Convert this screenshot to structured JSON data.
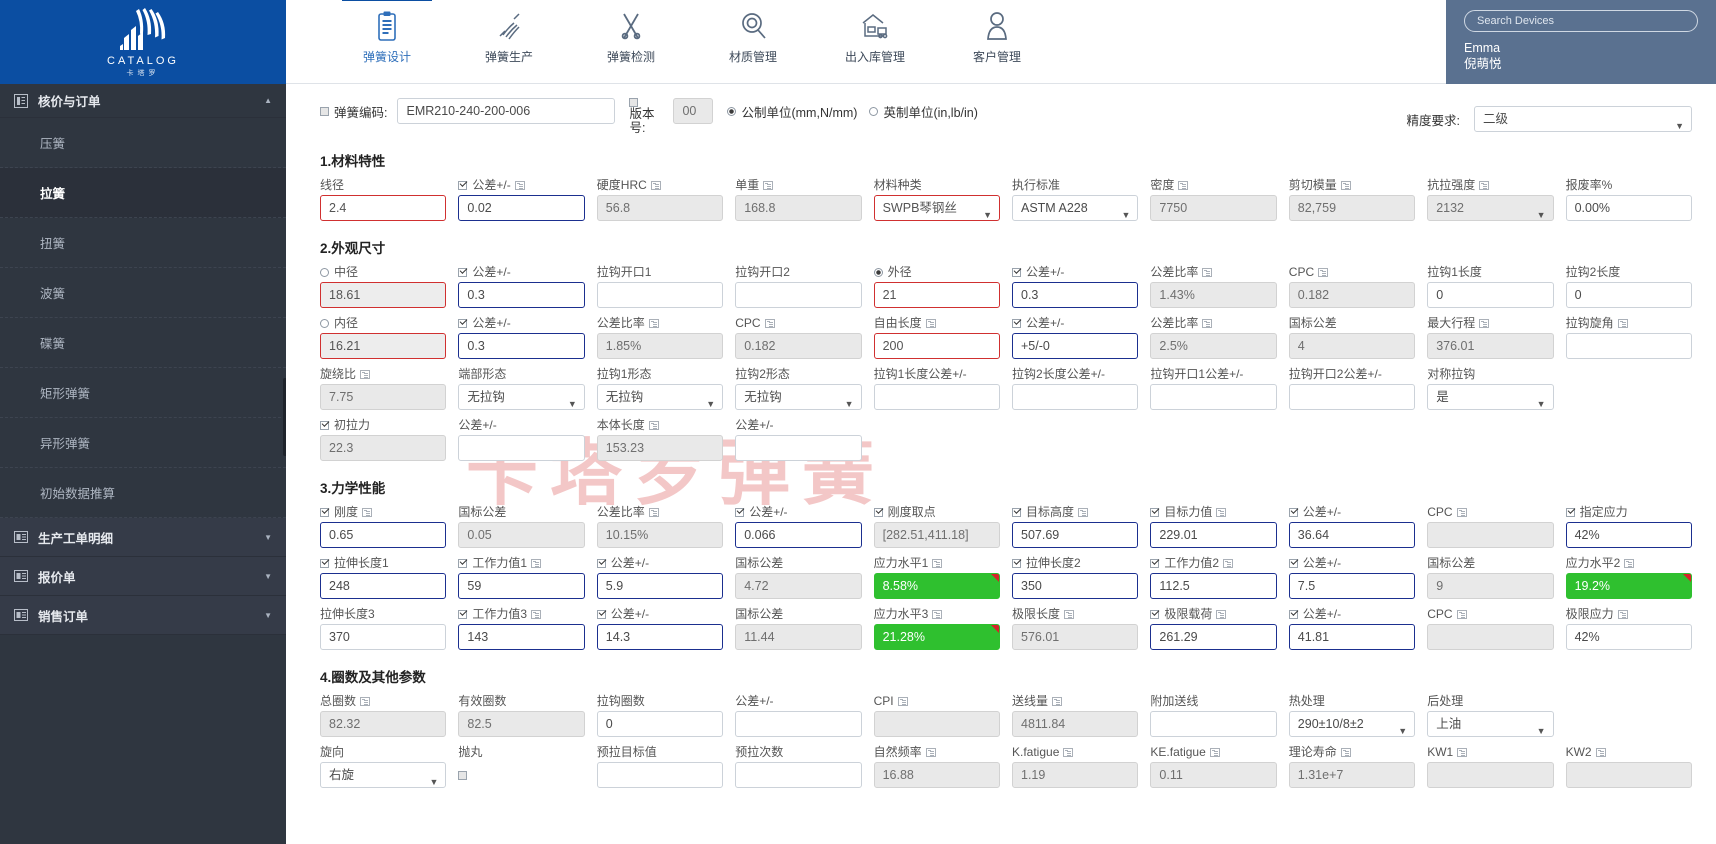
{
  "brand": {
    "name": "CATALOG",
    "sub": "卡塔罗"
  },
  "sidebar": {
    "group": {
      "label": "核价与订单",
      "icon": "list-icon"
    },
    "items": [
      {
        "label": "压簧"
      },
      {
        "label": "拉簧"
      },
      {
        "label": "扭簧"
      },
      {
        "label": "波簧"
      },
      {
        "label": "碟簧"
      },
      {
        "label": "矩形弹簧"
      },
      {
        "label": "异形弹簧"
      },
      {
        "label": "初始数据推算"
      }
    ],
    "groups2": [
      {
        "label": "生产工单明细"
      },
      {
        "label": "报价单"
      },
      {
        "label": "销售订单"
      }
    ]
  },
  "topnav": [
    {
      "label": "弹簧设计",
      "icon": "clipboard-icon",
      "active": true
    },
    {
      "label": "弹簧生产",
      "icon": "spring-icon",
      "active": false
    },
    {
      "label": "弹簧检测",
      "icon": "tools-icon",
      "active": false
    },
    {
      "label": "材质管理",
      "icon": "magnifier-coil-icon",
      "active": false
    },
    {
      "label": "出入库管理",
      "icon": "warehouse-truck-icon",
      "active": false
    },
    {
      "label": "客户管理",
      "icon": "user-icon",
      "active": false
    }
  ],
  "user": {
    "search_placeholder": "Search Devices",
    "name_en": "Emma",
    "name_cn": "倪萌悦"
  },
  "watermark": "卡塔罗弹簧",
  "header": {
    "code_label": "弹簧编码:",
    "code_value": "EMR210-240-200-006",
    "version_label": "版本号:",
    "version_value": "00",
    "unit_metric": "公制单位(mm,N/mm)",
    "unit_imperial": "英制单位(in,lb/in)",
    "precision_label": "精度要求:",
    "precision_value": "二级"
  },
  "sections": [
    {
      "title": "1.材料特性",
      "rows": [
        [
          {
            "label": "线径",
            "value": "2.4",
            "style": "redw",
            "check": "none"
          },
          {
            "label": "公差+/-",
            "value": "0.02",
            "style": "blue",
            "check": "on",
            "ico": true
          },
          {
            "label": "硬度HRC",
            "value": "56.8",
            "style": "gray",
            "check": "none",
            "ico": true
          },
          {
            "label": "单重",
            "value": "168.8",
            "style": "gray",
            "check": "none",
            "ico": true
          },
          {
            "label": "材料种类",
            "value": "SWPB琴钢丝",
            "style": "redw",
            "check": "none",
            "select": true
          },
          {
            "label": "执行标准",
            "value": "ASTM A228",
            "style": "plain",
            "check": "none",
            "select": true
          },
          {
            "label": "密度",
            "value": "7750",
            "style": "gray",
            "check": "none",
            "ico": true
          },
          {
            "label": "剪切模量",
            "value": "82,759",
            "style": "gray",
            "check": "none",
            "ico": true
          },
          {
            "label": "抗拉强度",
            "value": "2132",
            "style": "gray",
            "check": "none",
            "ico": true,
            "select": true
          },
          {
            "label": "报废率%",
            "value": "0.00%",
            "style": "plain",
            "check": "none"
          }
        ]
      ]
    },
    {
      "title": "2.外观尺寸",
      "rows": [
        [
          {
            "label": "中径",
            "value": "18.61",
            "style": "red",
            "check": "radio-off"
          },
          {
            "label": "公差+/-",
            "value": "0.3",
            "style": "blue",
            "check": "on"
          },
          {
            "label": "拉钩开口1",
            "value": "",
            "style": "plain",
            "check": "none"
          },
          {
            "label": "拉钩开口2",
            "value": "",
            "style": "plain",
            "check": "none"
          },
          {
            "label": "外径",
            "value": "21",
            "style": "redw",
            "check": "radio-on"
          },
          {
            "label": "公差+/-",
            "value": "0.3",
            "style": "blue",
            "check": "on"
          },
          {
            "label": "公差比率",
            "value": "1.43%",
            "style": "gray",
            "check": "none",
            "ico": true
          },
          {
            "label": "CPC",
            "value": "0.182",
            "style": "gray",
            "check": "none",
            "ico": true
          },
          {
            "label": "拉钩1长度",
            "value": "0",
            "style": "plain",
            "check": "none"
          },
          {
            "label": "拉钩2长度",
            "value": "0",
            "style": "plain",
            "check": "none"
          }
        ],
        [
          {
            "label": "内径",
            "value": "16.21",
            "style": "red",
            "check": "radio-off"
          },
          {
            "label": "公差+/-",
            "value": "0.3",
            "style": "blue",
            "check": "on"
          },
          {
            "label": "公差比率",
            "value": "1.85%",
            "style": "gray",
            "check": "none",
            "ico": true
          },
          {
            "label": "CPC",
            "value": "0.182",
            "style": "gray",
            "check": "none",
            "ico": true
          },
          {
            "label": "自由长度",
            "value": "200",
            "style": "redw",
            "check": "none",
            "ico": true
          },
          {
            "label": "公差+/-",
            "value": "+5/-0",
            "style": "blue",
            "check": "on"
          },
          {
            "label": "公差比率",
            "value": "2.5%",
            "style": "gray",
            "check": "none",
            "ico": true
          },
          {
            "label": "国标公差",
            "value": "4",
            "style": "gray",
            "check": "none"
          },
          {
            "label": "最大行程",
            "value": "376.01",
            "style": "gray",
            "check": "none",
            "ico": true
          },
          {
            "label": "拉钩旋角",
            "value": "",
            "style": "plain",
            "check": "none",
            "ico": true
          }
        ],
        [
          {
            "label": "旋绕比",
            "value": "7.75",
            "style": "gray",
            "check": "none",
            "ico": true
          },
          {
            "label": "端部形态",
            "value": "无拉钩",
            "style": "plain",
            "check": "none",
            "select": true
          },
          {
            "label": "拉钩1形态",
            "value": "无拉钩",
            "style": "plain",
            "check": "none",
            "select": true
          },
          {
            "label": "拉钩2形态",
            "value": "无拉钩",
            "style": "plain",
            "check": "none",
            "select": true
          },
          {
            "label": "拉钩1长度公差+/-",
            "value": "",
            "style": "plain",
            "check": "none",
            "wide2": true
          },
          {
            "label": "拉钩2长度公差+/-",
            "value": "",
            "style": "plain",
            "check": "none"
          },
          {
            "label": "拉钩开口1公差+/-",
            "value": "",
            "style": "plain",
            "check": "none"
          },
          {
            "label": "拉钩开口2公差+/-",
            "value": "",
            "style": "plain",
            "check": "none"
          },
          {
            "label": "对称拉钩",
            "value": "是",
            "style": "plain",
            "check": "none",
            "select": true
          }
        ],
        [
          {
            "label": "初拉力",
            "value": "22.3",
            "style": "gray",
            "check": "on"
          },
          {
            "label": "公差+/-",
            "value": "",
            "style": "plain",
            "check": "none"
          },
          {
            "label": "本体长度",
            "value": "153.23",
            "style": "gray",
            "check": "none",
            "ico": true
          },
          {
            "label": "公差+/-",
            "value": "",
            "style": "plain",
            "check": "none"
          }
        ]
      ]
    },
    {
      "title": "3.力学性能",
      "rows": [
        [
          {
            "label": "刚度",
            "value": "0.65",
            "style": "blue",
            "check": "on",
            "ico": true
          },
          {
            "label": "国标公差",
            "value": "0.05",
            "style": "gray",
            "check": "none"
          },
          {
            "label": "公差比率",
            "value": "10.15%",
            "style": "gray",
            "check": "none",
            "ico": true
          },
          {
            "label": "公差+/-",
            "value": "0.066",
            "style": "blue",
            "check": "on"
          },
          {
            "label": "刚度取点",
            "value": "[282.51,411.18]",
            "style": "gray",
            "check": "on"
          },
          {
            "label": "目标高度",
            "value": "507.69",
            "style": "blue",
            "check": "on",
            "ico": true
          },
          {
            "label": "目标力值",
            "value": "229.01",
            "style": "blue",
            "check": "on",
            "ico": true
          },
          {
            "label": "公差+/-",
            "value": "36.64",
            "style": "blue",
            "check": "on"
          },
          {
            "label": "CPC",
            "value": "",
            "style": "gray",
            "check": "none",
            "ico": true
          },
          {
            "label": "指定应力",
            "value": "42%",
            "style": "blue",
            "check": "on"
          }
        ],
        [
          {
            "label": "拉伸长度1",
            "value": "248",
            "style": "blue",
            "check": "on"
          },
          {
            "label": "工作力值1",
            "value": "59",
            "style": "blue",
            "check": "on",
            "ico": true
          },
          {
            "label": "公差+/-",
            "value": "5.9",
            "style": "blue",
            "check": "on"
          },
          {
            "label": "国标公差",
            "value": "4.72",
            "style": "gray",
            "check": "none"
          },
          {
            "label": "应力水平1",
            "value": "8.58%",
            "style": "green",
            "check": "none",
            "ico": true
          },
          {
            "label": "拉伸长度2",
            "value": "350",
            "style": "blue",
            "check": "on"
          },
          {
            "label": "工作力值2",
            "value": "112.5",
            "style": "blue",
            "check": "on",
            "ico": true
          },
          {
            "label": "公差+/-",
            "value": "7.5",
            "style": "blue",
            "check": "on"
          },
          {
            "label": "国标公差",
            "value": "9",
            "style": "gray",
            "check": "none"
          },
          {
            "label": "应力水平2",
            "value": "19.2%",
            "style": "green",
            "check": "none",
            "ico": true
          }
        ],
        [
          {
            "label": "拉伸长度3",
            "value": "370",
            "style": "plain",
            "check": "none"
          },
          {
            "label": "工作力值3",
            "value": "143",
            "style": "blue",
            "check": "on",
            "ico": true
          },
          {
            "label": "公差+/-",
            "value": "14.3",
            "style": "blue",
            "check": "on"
          },
          {
            "label": "国标公差",
            "value": "11.44",
            "style": "gray",
            "check": "none"
          },
          {
            "label": "应力水平3",
            "value": "21.28%",
            "style": "green",
            "check": "none",
            "ico": true
          },
          {
            "label": "极限长度",
            "value": "576.01",
            "style": "gray",
            "check": "none",
            "ico": true
          },
          {
            "label": "极限载荷",
            "value": "261.29",
            "style": "blue",
            "check": "on",
            "ico": true
          },
          {
            "label": "公差+/-",
            "value": "41.81",
            "style": "blue",
            "check": "on"
          },
          {
            "label": "CPC",
            "value": "",
            "style": "gray",
            "check": "none",
            "ico": true
          },
          {
            "label": "极限应力",
            "value": "42%",
            "style": "plain",
            "check": "none",
            "ico": true
          }
        ]
      ]
    },
    {
      "title": "4.圈数及其他参数",
      "rows": [
        [
          {
            "label": "总圈数",
            "value": "82.32",
            "style": "gray",
            "check": "none",
            "ico": true
          },
          {
            "label": "有效圈数",
            "value": "82.5",
            "style": "gray",
            "check": "none"
          },
          {
            "label": "拉钩圈数",
            "value": "0",
            "style": "plain",
            "check": "none"
          },
          {
            "label": "公差+/-",
            "value": "",
            "style": "plain",
            "check": "none"
          },
          {
            "label": "CPI",
            "value": "",
            "style": "gray",
            "check": "none",
            "ico": true
          },
          {
            "label": "送线量",
            "value": "4811.84",
            "style": "gray",
            "check": "none",
            "ico": true
          },
          {
            "label": "附加送线",
            "value": "",
            "style": "plain",
            "check": "none"
          },
          {
            "label": "热处理",
            "value": "290±10/8±2",
            "style": "plain",
            "check": "none",
            "select": true,
            "wide2": true
          },
          {
            "label": "后处理",
            "value": "上油",
            "style": "plain",
            "check": "none",
            "select": true
          }
        ],
        [
          {
            "label": "旋向",
            "value": "右旋",
            "style": "plain",
            "check": "none",
            "select": true
          },
          {
            "label": "抛丸",
            "value": "",
            "style": "none",
            "check": "cbxonly"
          },
          {
            "label": "预拉目标值",
            "value": "",
            "style": "plain",
            "check": "none"
          },
          {
            "label": "预拉次数",
            "value": "",
            "style": "plain",
            "check": "none"
          },
          {
            "label": "自然频率",
            "value": "16.88",
            "style": "gray",
            "check": "none",
            "ico": true
          },
          {
            "label": "K.fatigue",
            "value": "1.19",
            "style": "gray",
            "check": "none",
            "ico": true
          },
          {
            "label": "KE.fatigue",
            "value": "0.11",
            "style": "gray",
            "check": "none",
            "ico": true
          },
          {
            "label": "理论寿命",
            "value": "1.31e+7",
            "style": "gray",
            "check": "none",
            "ico": true
          },
          {
            "label": "KW1",
            "value": "",
            "style": "gray",
            "check": "none",
            "ico": true
          },
          {
            "label": "KW2",
            "value": "",
            "style": "gray",
            "check": "none",
            "ico": true
          }
        ]
      ]
    }
  ]
}
